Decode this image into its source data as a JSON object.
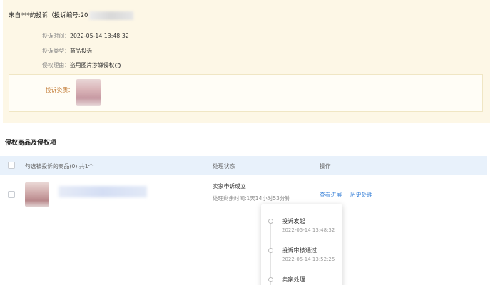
{
  "complaint": {
    "title_prefix": "来自***的投诉（投诉编号:20",
    "time_label": "投诉时间：",
    "time_value": "2022-05-14 13:48:32",
    "type_label": "投诉类型：",
    "type_value": "商品投诉",
    "reason_label": "侵权理由：",
    "reason_value": "盗用图片涉嫌侵权",
    "evidence_label": "投诉资质："
  },
  "section_title": "侵权商品及侵权项",
  "table": {
    "col_select": "勾选被投诉的商品(0),共1个",
    "col_status": "处理状态",
    "col_action": "操作"
  },
  "row": {
    "status": "卖家申诉成立",
    "remaining": "处理剩余时间:1天14小时53分钟",
    "view_progress": "查看进展",
    "history": "历史处理"
  },
  "timeline": [
    {
      "title": "投诉发起",
      "time": "2022-05-14 13:48:32"
    },
    {
      "title": "投诉审核通过",
      "time": "2022-05-14 13:52:25"
    },
    {
      "title": "卖家处理",
      "time": ""
    }
  ],
  "colors": {
    "card_bg": "#fdf7e6",
    "header_bg": "#e8f1fb",
    "link": "#3a82d8",
    "evidence_label": "#c1772f"
  }
}
